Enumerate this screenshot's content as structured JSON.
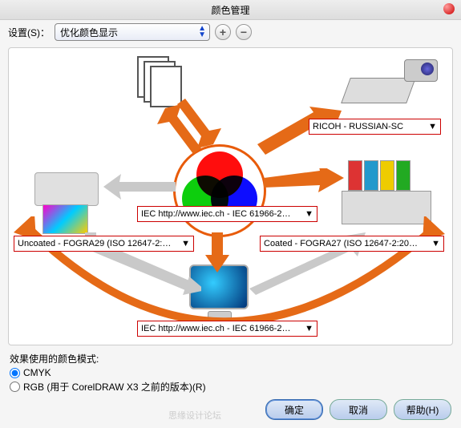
{
  "window": {
    "title": "颜色管理"
  },
  "toolbar": {
    "settings_label": "设置(S)：",
    "preset": "优化颜色显示",
    "add_tip": "+",
    "remove_tip": "−"
  },
  "diagram": {
    "scanner_profile": "RICOH - RUSSIAN-SC",
    "rgb_profile": "IEC http://www.iec.ch - IEC 61966-2…",
    "printer_profile": "Uncoated - FOGRA29 (ISO 12647-2:…",
    "press_profile": "Coated - FOGRA27 (ISO 12647-2:20…",
    "monitor_profile": "IEC http://www.iec.ch - IEC 61966-2…"
  },
  "effects": {
    "heading": "效果使用的颜色模式:",
    "cmyk_label": "CMYK",
    "rgb_label": "RGB (用于 CorelDRAW X3 之前的版本)(R)"
  },
  "buttons": {
    "ok": "确定",
    "cancel": "取消",
    "help": "帮助(H)"
  },
  "watermark": "思缘设计论坛"
}
